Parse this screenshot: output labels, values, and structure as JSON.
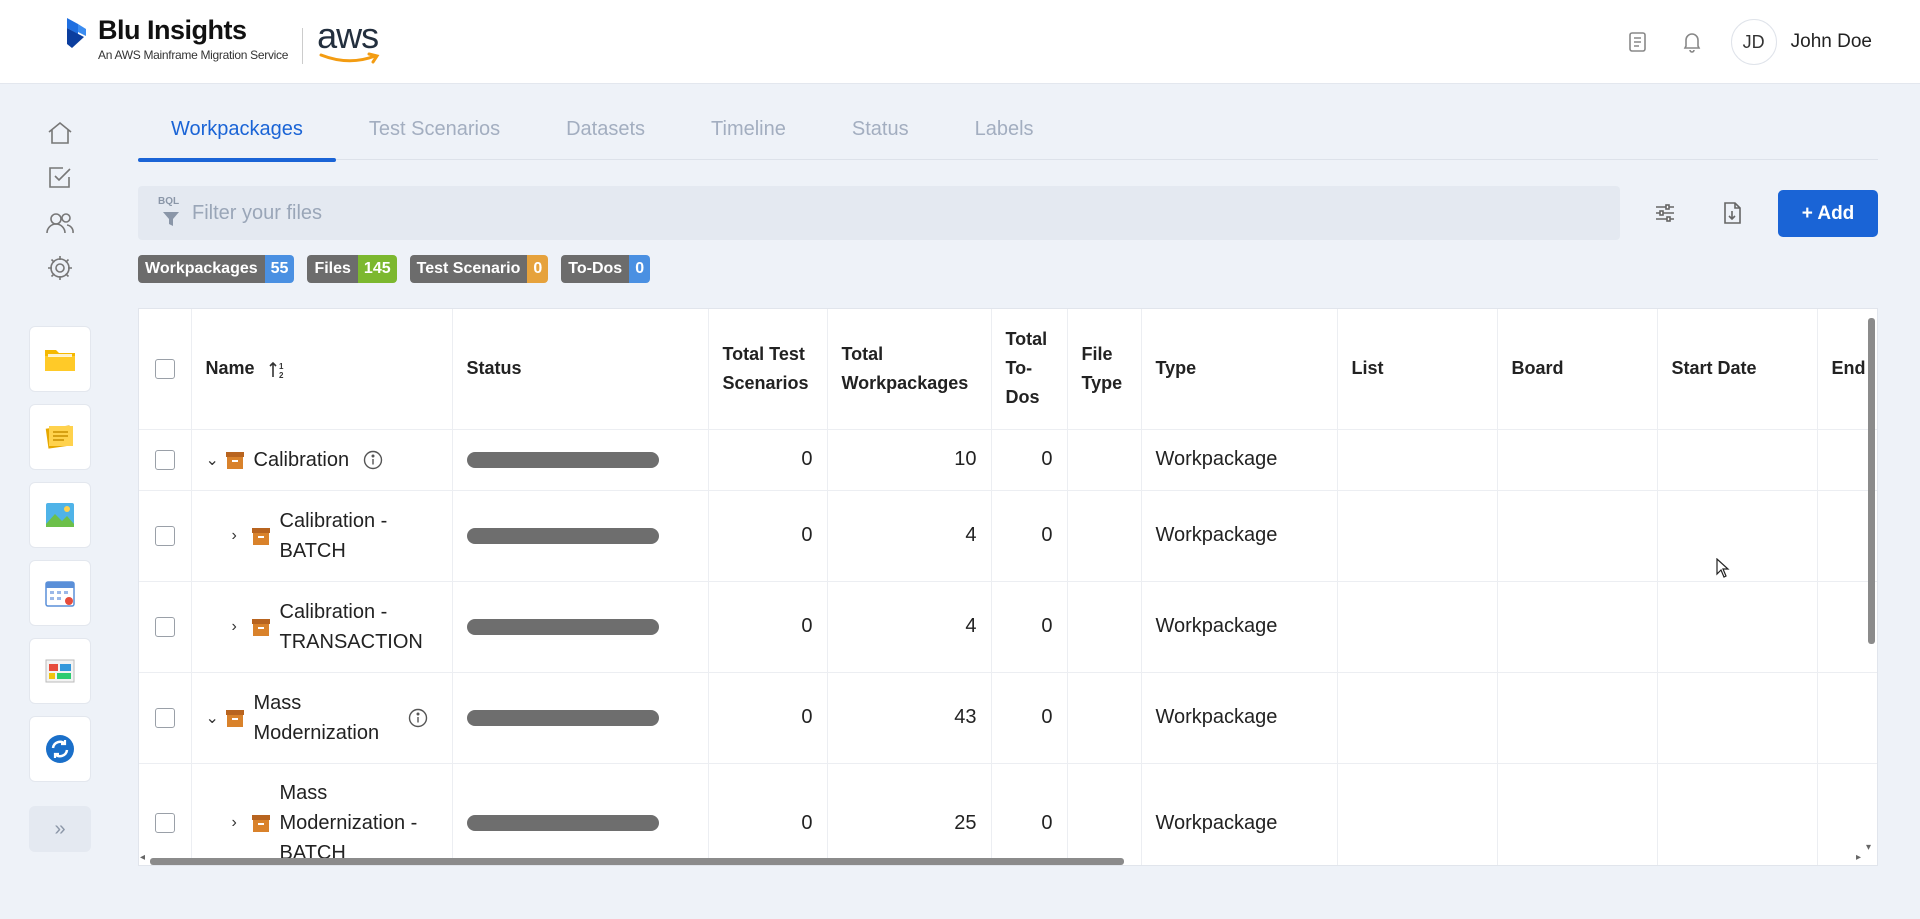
{
  "header": {
    "brand_title": "Blu Insights",
    "brand_subtitle": "An AWS Mainframe Migration Service",
    "partner_logo": "aws",
    "user_initials": "JD",
    "user_name": "John Doe",
    "icons": [
      "book-icon",
      "bell-icon"
    ]
  },
  "sidebar": {
    "nav_icons": [
      "home-icon",
      "checklist-icon",
      "users-icon",
      "gear-icon"
    ],
    "apps": [
      "folder-app",
      "notes-app",
      "image-app",
      "calendar-app",
      "dashboard-app",
      "sync-app"
    ],
    "expand_label": "»"
  },
  "tabs": [
    {
      "label": "Workpackages",
      "active": true
    },
    {
      "label": "Test Scenarios",
      "active": false
    },
    {
      "label": "Datasets",
      "active": false
    },
    {
      "label": "Timeline",
      "active": false
    },
    {
      "label": "Status",
      "active": false
    },
    {
      "label": "Labels",
      "active": false
    }
  ],
  "search": {
    "badge": "BQL",
    "placeholder": "Filter your files"
  },
  "toolbar": {
    "add_label": "+ Add"
  },
  "badges": [
    {
      "label": "Workpackages",
      "count": "55",
      "color": "#4a90e2"
    },
    {
      "label": "Files",
      "count": "145",
      "color": "#7cb82f"
    },
    {
      "label": "Test Scenario",
      "count": "0",
      "color": "#e6a23c"
    },
    {
      "label": "To-Dos",
      "count": "0",
      "color": "#4a90e2"
    }
  ],
  "table": {
    "columns": [
      "Name",
      "Status",
      "Total Test Scenarios",
      "Total Workpackages",
      "Total To-Dos",
      "File Type",
      "Type",
      "List",
      "Board",
      "Start Date",
      "End"
    ],
    "rows": [
      {
        "name": "Calibration",
        "level": 0,
        "expanded": true,
        "info": true,
        "test_scenarios": "0",
        "workpackages": "10",
        "todos": "0",
        "file_type": "",
        "type": "Workpackage"
      },
      {
        "name": "Calibration - BATCH",
        "level": 1,
        "expanded": false,
        "info": false,
        "test_scenarios": "0",
        "workpackages": "4",
        "todos": "0",
        "file_type": "",
        "type": "Workpackage"
      },
      {
        "name": "Calibration - TRANSACTION",
        "level": 1,
        "expanded": false,
        "info": false,
        "test_scenarios": "0",
        "workpackages": "4",
        "todos": "0",
        "file_type": "",
        "type": "Workpackage"
      },
      {
        "name": "Mass Modernization",
        "level": 0,
        "expanded": true,
        "info": true,
        "test_scenarios": "0",
        "workpackages": "43",
        "todos": "0",
        "file_type": "",
        "type": "Workpackage"
      },
      {
        "name": "Mass Modernization - BATCH",
        "level": 1,
        "expanded": false,
        "info": false,
        "test_scenarios": "0",
        "workpackages": "25",
        "todos": "0",
        "file_type": "",
        "type": "Workpackage"
      }
    ]
  }
}
